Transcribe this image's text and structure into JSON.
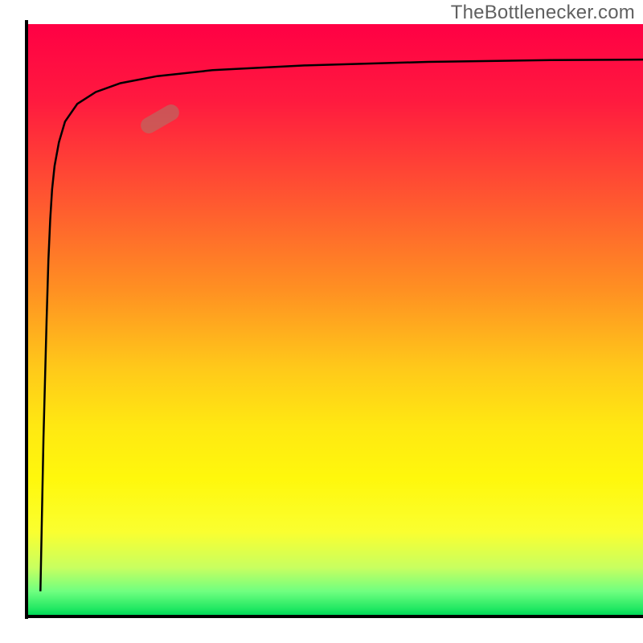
{
  "watermark": "TheBottlenecker.com",
  "colors": {
    "axis": "#000000",
    "curve": "#000000",
    "marker_fill": "rgba(180,110,100,0.65)",
    "gradient_top": "#ff0044",
    "gradient_bottom": "#00d858"
  },
  "chart_data": {
    "type": "line",
    "title": "",
    "xlabel": "",
    "ylabel": "",
    "xlim": [
      0,
      100
    ],
    "ylim": [
      0,
      100
    ],
    "series": [
      {
        "name": "curve",
        "x": [
          2.0,
          2.5,
          3.0,
          3.3,
          3.6,
          3.9,
          4.3,
          5.0,
          6.0,
          8.0,
          11.0,
          15.0,
          21.0,
          30.0,
          45.0,
          65.0,
          85.0,
          100.0
        ],
        "y": [
          4.0,
          30.0,
          50.0,
          60.0,
          67.0,
          72.0,
          76.0,
          80.0,
          83.5,
          86.5,
          88.5,
          90.0,
          91.2,
          92.2,
          93.0,
          93.6,
          93.9,
          94.0
        ]
      }
    ],
    "marker": {
      "x": 21.5,
      "y": 84.0,
      "angle_deg": -30
    },
    "notes": "Axes are unlabeled in the source image; values are read as percentages of the plotting area. The curve starts near the bottom-left, rises extremely steeply along the y-axis, then bends and asymptotically approaches y≈94 across the width. A single rounded marker sits on the curve near the upper-left bend."
  }
}
